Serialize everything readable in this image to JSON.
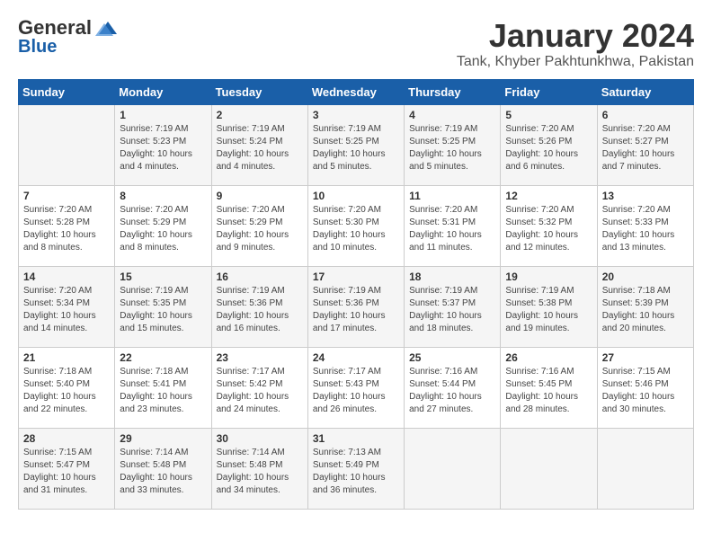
{
  "header": {
    "logo_general": "General",
    "logo_blue": "Blue",
    "title": "January 2024",
    "subtitle": "Tank, Khyber Pakhtunkhwa, Pakistan"
  },
  "days_of_week": [
    "Sunday",
    "Monday",
    "Tuesday",
    "Wednesday",
    "Thursday",
    "Friday",
    "Saturday"
  ],
  "weeks": [
    [
      {
        "day": "",
        "info": ""
      },
      {
        "day": "1",
        "info": "Sunrise: 7:19 AM\nSunset: 5:23 PM\nDaylight: 10 hours\nand 4 minutes."
      },
      {
        "day": "2",
        "info": "Sunrise: 7:19 AM\nSunset: 5:24 PM\nDaylight: 10 hours\nand 4 minutes."
      },
      {
        "day": "3",
        "info": "Sunrise: 7:19 AM\nSunset: 5:25 PM\nDaylight: 10 hours\nand 5 minutes."
      },
      {
        "day": "4",
        "info": "Sunrise: 7:19 AM\nSunset: 5:25 PM\nDaylight: 10 hours\nand 5 minutes."
      },
      {
        "day": "5",
        "info": "Sunrise: 7:20 AM\nSunset: 5:26 PM\nDaylight: 10 hours\nand 6 minutes."
      },
      {
        "day": "6",
        "info": "Sunrise: 7:20 AM\nSunset: 5:27 PM\nDaylight: 10 hours\nand 7 minutes."
      }
    ],
    [
      {
        "day": "7",
        "info": "Sunrise: 7:20 AM\nSunset: 5:28 PM\nDaylight: 10 hours\nand 8 minutes."
      },
      {
        "day": "8",
        "info": "Sunrise: 7:20 AM\nSunset: 5:29 PM\nDaylight: 10 hours\nand 8 minutes."
      },
      {
        "day": "9",
        "info": "Sunrise: 7:20 AM\nSunset: 5:29 PM\nDaylight: 10 hours\nand 9 minutes."
      },
      {
        "day": "10",
        "info": "Sunrise: 7:20 AM\nSunset: 5:30 PM\nDaylight: 10 hours\nand 10 minutes."
      },
      {
        "day": "11",
        "info": "Sunrise: 7:20 AM\nSunset: 5:31 PM\nDaylight: 10 hours\nand 11 minutes."
      },
      {
        "day": "12",
        "info": "Sunrise: 7:20 AM\nSunset: 5:32 PM\nDaylight: 10 hours\nand 12 minutes."
      },
      {
        "day": "13",
        "info": "Sunrise: 7:20 AM\nSunset: 5:33 PM\nDaylight: 10 hours\nand 13 minutes."
      }
    ],
    [
      {
        "day": "14",
        "info": "Sunrise: 7:20 AM\nSunset: 5:34 PM\nDaylight: 10 hours\nand 14 minutes."
      },
      {
        "day": "15",
        "info": "Sunrise: 7:19 AM\nSunset: 5:35 PM\nDaylight: 10 hours\nand 15 minutes."
      },
      {
        "day": "16",
        "info": "Sunrise: 7:19 AM\nSunset: 5:36 PM\nDaylight: 10 hours\nand 16 minutes."
      },
      {
        "day": "17",
        "info": "Sunrise: 7:19 AM\nSunset: 5:36 PM\nDaylight: 10 hours\nand 17 minutes."
      },
      {
        "day": "18",
        "info": "Sunrise: 7:19 AM\nSunset: 5:37 PM\nDaylight: 10 hours\nand 18 minutes."
      },
      {
        "day": "19",
        "info": "Sunrise: 7:19 AM\nSunset: 5:38 PM\nDaylight: 10 hours\nand 19 minutes."
      },
      {
        "day": "20",
        "info": "Sunrise: 7:18 AM\nSunset: 5:39 PM\nDaylight: 10 hours\nand 20 minutes."
      }
    ],
    [
      {
        "day": "21",
        "info": "Sunrise: 7:18 AM\nSunset: 5:40 PM\nDaylight: 10 hours\nand 22 minutes."
      },
      {
        "day": "22",
        "info": "Sunrise: 7:18 AM\nSunset: 5:41 PM\nDaylight: 10 hours\nand 23 minutes."
      },
      {
        "day": "23",
        "info": "Sunrise: 7:17 AM\nSunset: 5:42 PM\nDaylight: 10 hours\nand 24 minutes."
      },
      {
        "day": "24",
        "info": "Sunrise: 7:17 AM\nSunset: 5:43 PM\nDaylight: 10 hours\nand 26 minutes."
      },
      {
        "day": "25",
        "info": "Sunrise: 7:16 AM\nSunset: 5:44 PM\nDaylight: 10 hours\nand 27 minutes."
      },
      {
        "day": "26",
        "info": "Sunrise: 7:16 AM\nSunset: 5:45 PM\nDaylight: 10 hours\nand 28 minutes."
      },
      {
        "day": "27",
        "info": "Sunrise: 7:15 AM\nSunset: 5:46 PM\nDaylight: 10 hours\nand 30 minutes."
      }
    ],
    [
      {
        "day": "28",
        "info": "Sunrise: 7:15 AM\nSunset: 5:47 PM\nDaylight: 10 hours\nand 31 minutes."
      },
      {
        "day": "29",
        "info": "Sunrise: 7:14 AM\nSunset: 5:48 PM\nDaylight: 10 hours\nand 33 minutes."
      },
      {
        "day": "30",
        "info": "Sunrise: 7:14 AM\nSunset: 5:48 PM\nDaylight: 10 hours\nand 34 minutes."
      },
      {
        "day": "31",
        "info": "Sunrise: 7:13 AM\nSunset: 5:49 PM\nDaylight: 10 hours\nand 36 minutes."
      },
      {
        "day": "",
        "info": ""
      },
      {
        "day": "",
        "info": ""
      },
      {
        "day": "",
        "info": ""
      }
    ]
  ]
}
